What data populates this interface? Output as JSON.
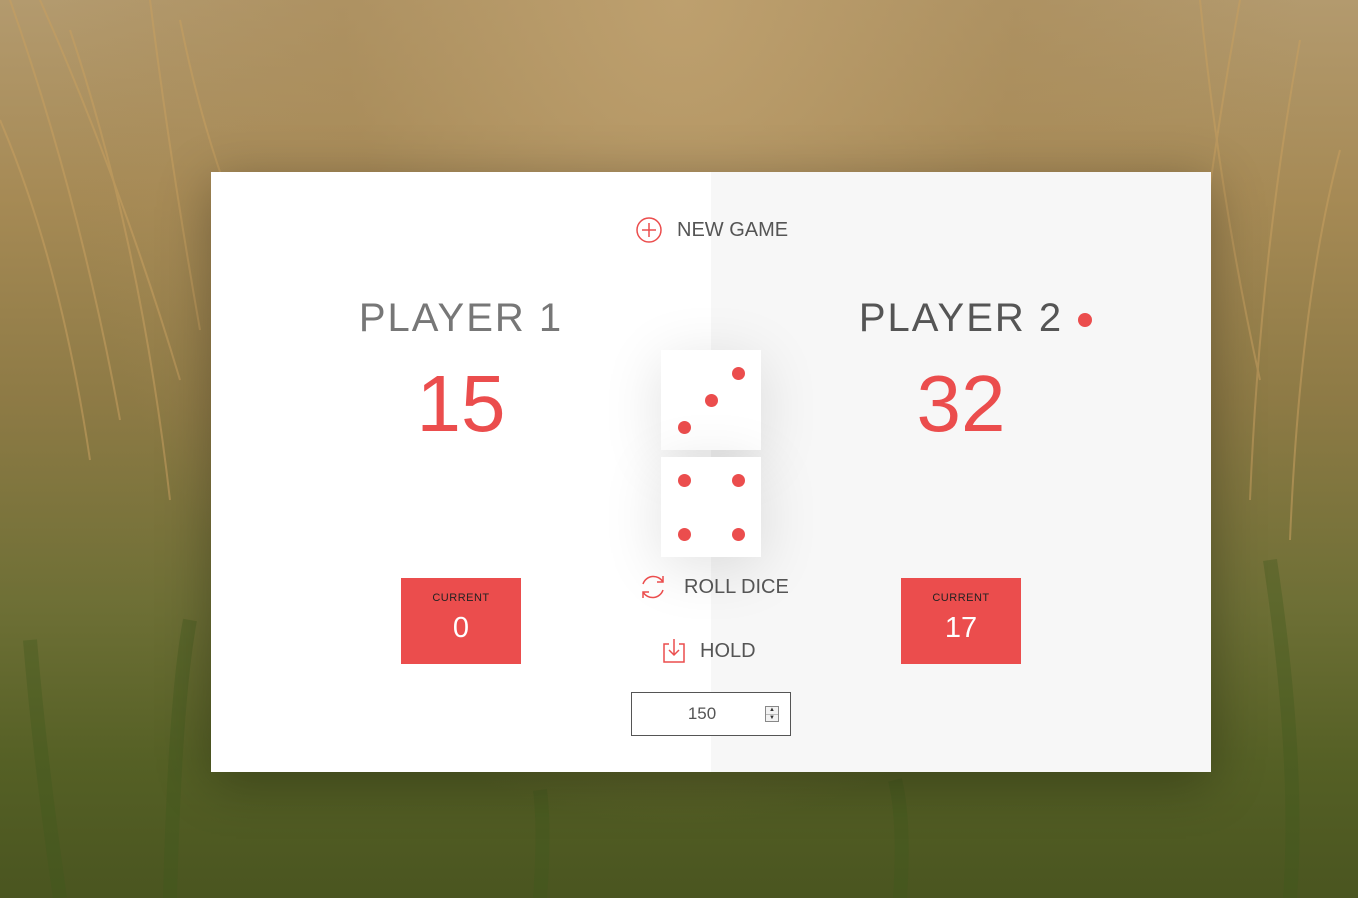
{
  "colors": {
    "accent": "#EB4D4D",
    "text": "#555555"
  },
  "actions": {
    "new_game_label": "NEW GAME",
    "new_game_icon": "plus-circle-icon",
    "roll_label": "ROLL DICE",
    "roll_icon": "refresh-icon",
    "hold_label": "HOLD",
    "hold_icon": "download-icon"
  },
  "players": [
    {
      "name": "PLAYER 1",
      "score": "15",
      "current_label": "CURRENT",
      "current": "0",
      "active": false
    },
    {
      "name": "PLAYER 2",
      "score": "32",
      "current_label": "CURRENT",
      "current": "17",
      "active": true
    }
  ],
  "dice": [
    3,
    4
  ],
  "final_score": {
    "value": "150"
  }
}
